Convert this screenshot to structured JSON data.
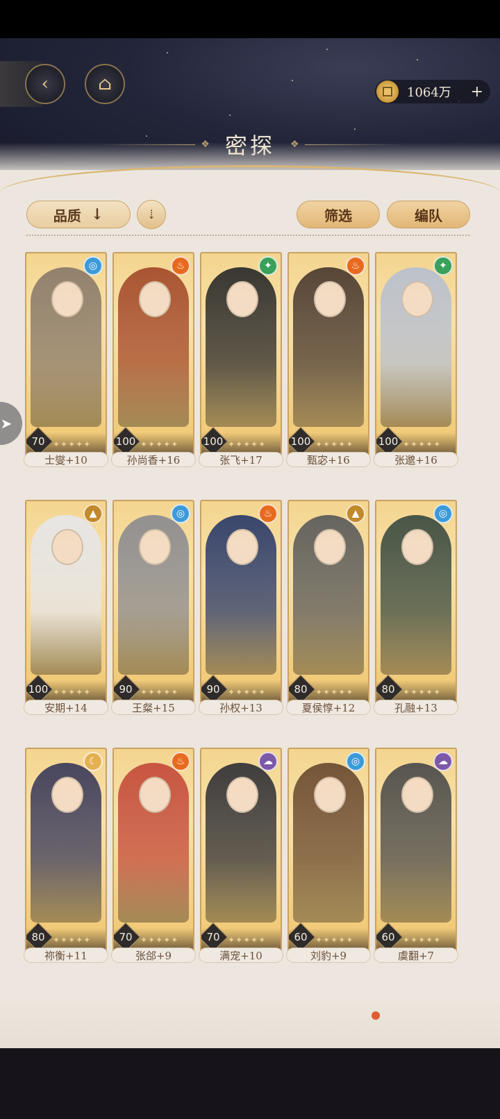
{
  "header": {
    "title": "密探",
    "back_icon": "back-arrow-icon",
    "home_icon": "pavilion-icon",
    "currency_amount": "1064万",
    "currency_plus": "+"
  },
  "toolbar": {
    "sort_label": "品质",
    "sort_arrow": "↓",
    "sort_toggle": "⇣",
    "filter_label": "筛选",
    "team_label": "编队"
  },
  "colors": {
    "accent_gold": "#c9a46a",
    "background": "#ece6de",
    "element_water": "#3d9ad8",
    "element_fire": "#e86a1f",
    "element_wind": "#3aa05a",
    "element_earth": "#c2892a",
    "element_moon": "#e4b050",
    "element_dark": "#7c58a8"
  },
  "characters": [
    {
      "name": "士燮+10",
      "level": "70",
      "element": "water",
      "element_icon": "water-swirl-icon"
    },
    {
      "name": "孙尚香+16",
      "level": "100",
      "element": "fire",
      "element_icon": "flame-icon"
    },
    {
      "name": "张飞+17",
      "level": "100",
      "element": "wind",
      "element_icon": "wind-icon"
    },
    {
      "name": "甄宓+16",
      "level": "100",
      "element": "fire",
      "element_icon": "flame-icon"
    },
    {
      "name": "张邈+16",
      "level": "100",
      "element": "wind",
      "element_icon": "wind-icon"
    },
    {
      "name": "安期+14",
      "level": "100",
      "element": "earth",
      "element_icon": "mountain-icon"
    },
    {
      "name": "王粲+15",
      "level": "90",
      "element": "water",
      "element_icon": "water-swirl-icon"
    },
    {
      "name": "孙权+13",
      "level": "90",
      "element": "fire",
      "element_icon": "flame-icon"
    },
    {
      "name": "夏侯惇+12",
      "level": "80",
      "element": "earth",
      "element_icon": "mountain-icon"
    },
    {
      "name": "孔融+13",
      "level": "80",
      "element": "water",
      "element_icon": "water-swirl-icon"
    },
    {
      "name": "祢衡+11",
      "level": "80",
      "element": "moon",
      "element_icon": "crescent-moon-icon"
    },
    {
      "name": "张郃+9",
      "level": "70",
      "element": "fire",
      "element_icon": "flame-icon"
    },
    {
      "name": "满宠+10",
      "level": "70",
      "element": "dark",
      "element_icon": "cloud-swirl-icon"
    },
    {
      "name": "刘豹+9",
      "level": "60",
      "element": "water",
      "element_icon": "water-swirl-icon"
    },
    {
      "name": "虞翻+7",
      "level": "60",
      "element": "dark",
      "element_icon": "cloud-swirl-icon"
    }
  ]
}
